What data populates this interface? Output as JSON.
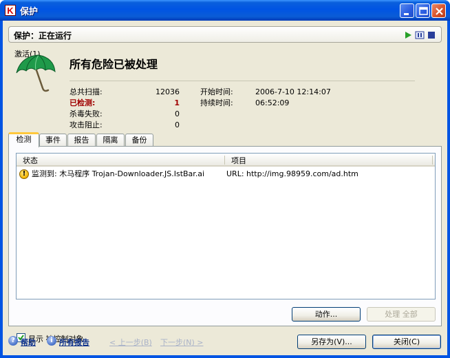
{
  "window": {
    "title": "保护"
  },
  "statusbar": {
    "label": "保护：正在运行"
  },
  "summary": {
    "activate": "激活(1)",
    "headline": "所有危险已被处理",
    "stats": [
      {
        "label": "总共扫描:",
        "value": "12036"
      },
      {
        "label": "已检测:",
        "value": "1"
      },
      {
        "label": "杀毒失败:",
        "value": "0"
      },
      {
        "label": "攻击阻止:",
        "value": "0"
      }
    ],
    "times": [
      {
        "label": "开始时间:",
        "value": "2006-7-10 12:14:07"
      },
      {
        "label": "持续时间:",
        "value": "06:52:09"
      }
    ]
  },
  "tabs": [
    "检测",
    "事件",
    "报告",
    "隔离",
    "备份"
  ],
  "table": {
    "columns": [
      "状态",
      "项目"
    ],
    "rows": [
      {
        "status": "监测到: 木马程序 Trojan-Downloader.JS.IstBar.ai",
        "item": "URL: http://img.98959.com/ad.htm"
      }
    ]
  },
  "panel": {
    "show_label": "显示 被控制对象",
    "action_button": "动作...",
    "process_all_button": "处理 全部"
  },
  "footer": {
    "help": "帮助",
    "all_reports": "所有报告",
    "prev": "< 上一步(B)",
    "next": "下一步(N) >",
    "save_as": "另存为(V)...",
    "close": "关闭(C)"
  }
}
